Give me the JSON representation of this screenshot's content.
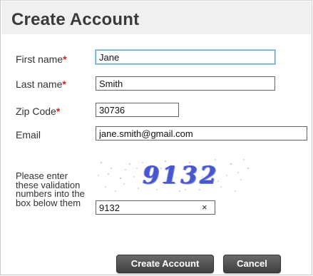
{
  "form": {
    "title": "Create Account",
    "required_marker": "*",
    "first_name": {
      "label": "First name",
      "value": "Jane"
    },
    "last_name": {
      "label": "Last name",
      "value": "Smith"
    },
    "zip": {
      "label": "Zip Code",
      "value": "30736"
    },
    "email": {
      "label": "Email",
      "value": "jane.smith@gmail.com"
    },
    "captcha": {
      "instructions": "Please enter these validation numbers into the box below them",
      "image_text": "9132",
      "value": "9132",
      "clear_glyph": "×"
    },
    "buttons": {
      "create": "Create Account",
      "cancel": "Cancel"
    }
  },
  "colors": {
    "required": "#c8251d",
    "focus_border": "#53a6d6",
    "button_bg": "#4e4e4e",
    "captcha_text": "#3a4fd0"
  }
}
